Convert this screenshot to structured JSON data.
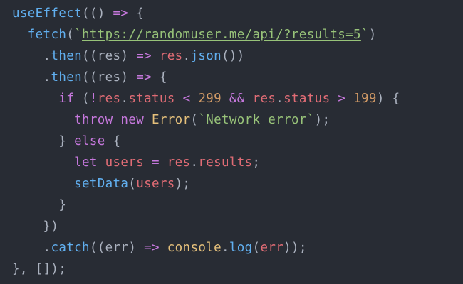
{
  "editor": {
    "theme": {
      "background": "#282c34",
      "default": "#abb2bf",
      "function": "#61afef",
      "keyword": "#c678dd",
      "variable": "#e06c75",
      "string": "#98c379",
      "number": "#d19a66",
      "class": "#e5c07b"
    },
    "lines": [
      {
        "indent": "",
        "tokens": [
          [
            "fn",
            "useEffect"
          ],
          [
            "punc",
            "(() "
          ],
          [
            "op",
            "=>"
          ],
          [
            "punc",
            " {"
          ]
        ]
      },
      {
        "indent": "  ",
        "tokens": [
          [
            "fn",
            "fetch"
          ],
          [
            "punc",
            "("
          ],
          [
            "str",
            "`"
          ],
          [
            "url",
            "https://randomuser.me/api/?results=5"
          ],
          [
            "str",
            "`"
          ],
          [
            "punc",
            ")"
          ]
        ]
      },
      {
        "indent": "    ",
        "tokens": [
          [
            "punc",
            "."
          ],
          [
            "fn",
            "then"
          ],
          [
            "punc",
            "(("
          ],
          [
            "punc",
            "res"
          ],
          [
            "punc",
            ") "
          ],
          [
            "op",
            "=>"
          ],
          [
            "punc",
            " "
          ],
          [
            "var",
            "res"
          ],
          [
            "punc",
            "."
          ],
          [
            "fn",
            "json"
          ],
          [
            "punc",
            "())"
          ]
        ]
      },
      {
        "indent": "    ",
        "tokens": [
          [
            "punc",
            "."
          ],
          [
            "fn",
            "then"
          ],
          [
            "punc",
            "(("
          ],
          [
            "punc",
            "res"
          ],
          [
            "punc",
            ") "
          ],
          [
            "op",
            "=>"
          ],
          [
            "punc",
            " {"
          ]
        ]
      },
      {
        "indent": "      ",
        "tokens": [
          [
            "kw",
            "if"
          ],
          [
            "punc",
            " ("
          ],
          [
            "op",
            "!"
          ],
          [
            "var",
            "res"
          ],
          [
            "punc",
            "."
          ],
          [
            "var",
            "status"
          ],
          [
            "punc",
            " "
          ],
          [
            "op",
            "<"
          ],
          [
            "punc",
            " "
          ],
          [
            "num",
            "299"
          ],
          [
            "punc",
            " "
          ],
          [
            "op",
            "&&"
          ],
          [
            "punc",
            " "
          ],
          [
            "var",
            "res"
          ],
          [
            "punc",
            "."
          ],
          [
            "var",
            "status"
          ],
          [
            "punc",
            " "
          ],
          [
            "op",
            ">"
          ],
          [
            "punc",
            " "
          ],
          [
            "num",
            "199"
          ],
          [
            "punc",
            ") {"
          ]
        ]
      },
      {
        "indent": "        ",
        "tokens": [
          [
            "kw",
            "throw"
          ],
          [
            "punc",
            " "
          ],
          [
            "kw",
            "new"
          ],
          [
            "punc",
            " "
          ],
          [
            "cls",
            "Error"
          ],
          [
            "punc",
            "("
          ],
          [
            "str",
            "`Network error`"
          ],
          [
            "punc",
            ");"
          ]
        ]
      },
      {
        "indent": "      ",
        "tokens": [
          [
            "punc",
            "} "
          ],
          [
            "kw",
            "else"
          ],
          [
            "punc",
            " {"
          ]
        ]
      },
      {
        "indent": "        ",
        "tokens": [
          [
            "kw",
            "let"
          ],
          [
            "punc",
            " "
          ],
          [
            "var",
            "users"
          ],
          [
            "punc",
            " "
          ],
          [
            "op",
            "="
          ],
          [
            "punc",
            " "
          ],
          [
            "var",
            "res"
          ],
          [
            "punc",
            "."
          ],
          [
            "var",
            "results"
          ],
          [
            "punc",
            ";"
          ]
        ]
      },
      {
        "indent": "        ",
        "tokens": [
          [
            "fn",
            "setData"
          ],
          [
            "punc",
            "("
          ],
          [
            "var",
            "users"
          ],
          [
            "punc",
            ");"
          ]
        ]
      },
      {
        "indent": "      ",
        "tokens": [
          [
            "punc",
            "}"
          ]
        ]
      },
      {
        "indent": "    ",
        "tokens": [
          [
            "punc",
            "})"
          ]
        ]
      },
      {
        "indent": "    ",
        "tokens": [
          [
            "punc",
            "."
          ],
          [
            "fn",
            "catch"
          ],
          [
            "punc",
            "(("
          ],
          [
            "punc",
            "err"
          ],
          [
            "punc",
            ") "
          ],
          [
            "op",
            "=>"
          ],
          [
            "punc",
            " "
          ],
          [
            "cls",
            "console"
          ],
          [
            "punc",
            "."
          ],
          [
            "fn",
            "log"
          ],
          [
            "punc",
            "("
          ],
          [
            "var",
            "err"
          ],
          [
            "punc",
            "));"
          ]
        ]
      },
      {
        "indent": "",
        "tokens": [
          [
            "punc",
            "}, []);"
          ]
        ]
      }
    ]
  }
}
